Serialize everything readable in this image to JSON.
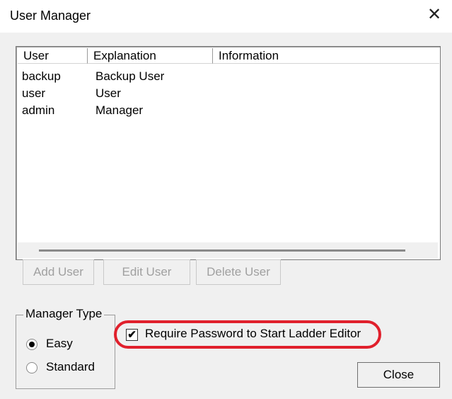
{
  "window": {
    "title": "User Manager",
    "close_glyph": "✕"
  },
  "list": {
    "columns": [
      "User",
      "Explanation",
      "Information"
    ],
    "rows": [
      {
        "user": "backup",
        "explanation": "Backup User",
        "information": ""
      },
      {
        "user": "user",
        "explanation": "User",
        "information": ""
      },
      {
        "user": "admin",
        "explanation": "Manager",
        "information": ""
      }
    ]
  },
  "buttons": {
    "add": "Add User",
    "edit": "Edit User",
    "delete": "Delete User",
    "close": "Close"
  },
  "manager_type": {
    "label": "Manager Type",
    "options": [
      {
        "label": "Easy",
        "selected": true
      },
      {
        "label": "Standard",
        "selected": false
      }
    ]
  },
  "require_password": {
    "label": "Require Password to Start Ladder Editor",
    "checked": true,
    "check_glyph": "✔"
  },
  "colors": {
    "highlight": "#e0202c",
    "window_bg": "#f0f0f0",
    "disabled_text": "#a0a0a0"
  }
}
